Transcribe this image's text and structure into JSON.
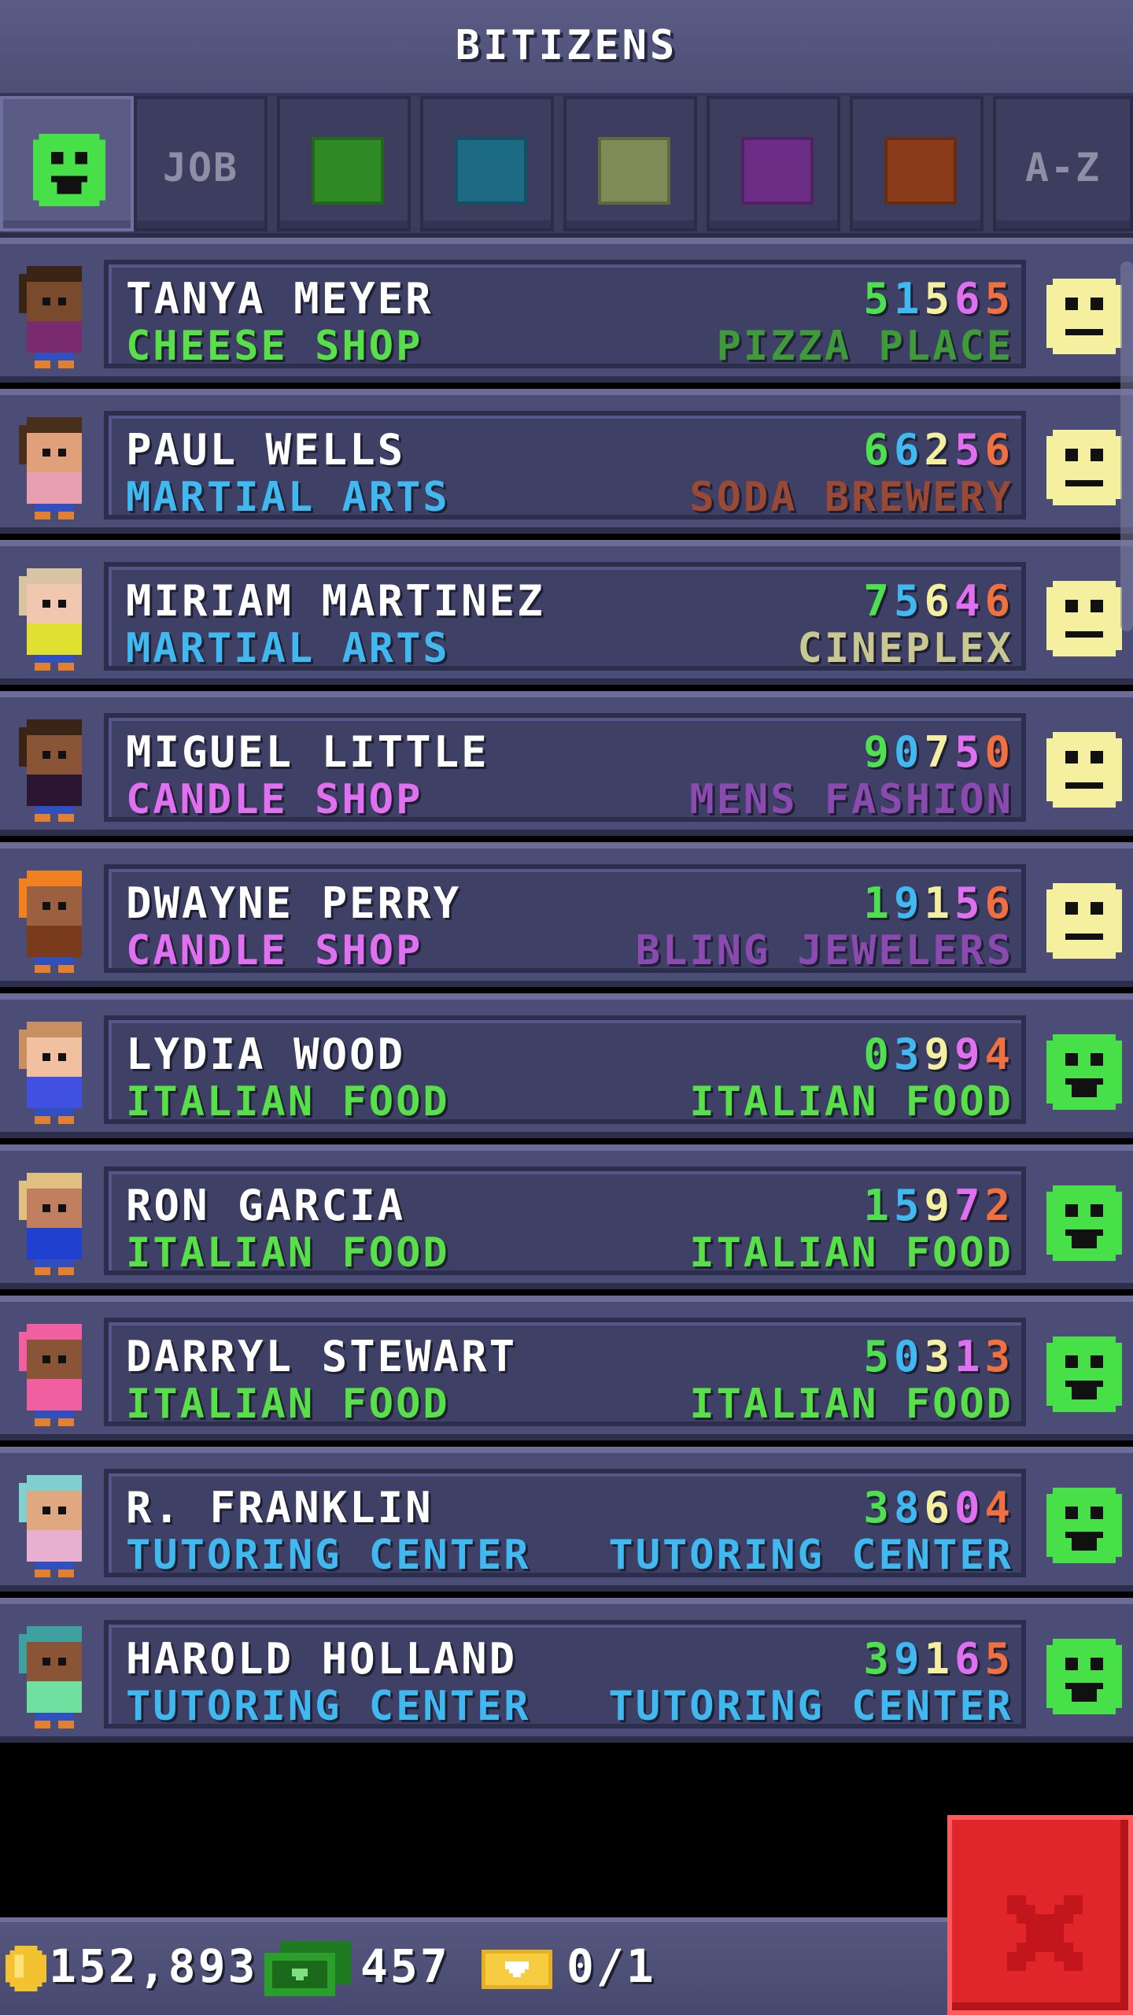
{
  "header": {
    "title": "BITIZENS"
  },
  "tabs": [
    {
      "kind": "icon",
      "icon": "happy-face-icon",
      "color": "#48e048",
      "label": ""
    },
    {
      "kind": "text",
      "label": "JOB"
    },
    {
      "kind": "color",
      "color": "#2f8a26",
      "label": ""
    },
    {
      "kind": "color",
      "color": "#1d6a85",
      "label": ""
    },
    {
      "kind": "color",
      "color": "#7f8a56",
      "label": ""
    },
    {
      "kind": "color",
      "color": "#6b2d86",
      "label": ""
    },
    {
      "kind": "color",
      "color": "#8a3c1a",
      "label": ""
    },
    {
      "kind": "text",
      "label": "A-Z"
    }
  ],
  "stat_colors": [
    "#4fe04f",
    "#40b8f0",
    "#f4f0a0",
    "#e070f0",
    "#f07040"
  ],
  "bitizens": [
    {
      "name": "TANYA MEYER",
      "stats": [
        "5",
        "1",
        "5",
        "6",
        "5"
      ],
      "job": "CHEESE SHOP",
      "job_color": "#58e048",
      "dream_job": "PIZZA PLACE",
      "dream_color": "#3f9a3a",
      "mood": "neutral",
      "skin": "#7a4a2c",
      "hair": "#3a2416",
      "shirt": "#7a2a6e"
    },
    {
      "name": "PAUL WELLS",
      "stats": [
        "6",
        "6",
        "2",
        "5",
        "6"
      ],
      "job": "MARTIAL ARTS",
      "job_color": "#40b8f0",
      "dream_job": "SODA BREWERY",
      "dream_color": "#9a4a34",
      "mood": "neutral",
      "skin": "#e0a07a",
      "hair": "#4a2e1c",
      "shirt": "#e8a0b0"
    },
    {
      "name": "MIRIAM MARTINEZ",
      "stats": [
        "7",
        "5",
        "6",
        "4",
        "6"
      ],
      "job": "MARTIAL ARTS",
      "job_color": "#40b8f0",
      "dream_job": "CINEPLEX",
      "dream_color": "#c8c890",
      "mood": "neutral",
      "skin": "#f0c8b0",
      "hair": "#d8c4a0",
      "shirt": "#e0e030"
    },
    {
      "name": "MIGUEL LITTLE",
      "stats": [
        "9",
        "0",
        "7",
        "5",
        "0"
      ],
      "job": "CANDLE SHOP",
      "job_color": "#e070f0",
      "dream_job": "MENS FASHION",
      "dream_color": "#8a4ab0",
      "mood": "neutral",
      "skin": "#8a5436",
      "hair": "#3a2416",
      "shirt": "#2a1630"
    },
    {
      "name": "DWAYNE PERRY",
      "stats": [
        "1",
        "9",
        "1",
        "5",
        "6"
      ],
      "job": "CANDLE SHOP",
      "job_color": "#e070f0",
      "dream_job": "BLING JEWELERS",
      "dream_color": "#8a4ab0",
      "mood": "neutral",
      "skin": "#9a6040",
      "hair": "#f08020",
      "shirt": "#7a3a1c"
    },
    {
      "name": "LYDIA WOOD",
      "stats": [
        "0",
        "3",
        "9",
        "9",
        "4"
      ],
      "job": "ITALIAN FOOD",
      "job_color": "#58e048",
      "dream_job": "ITALIAN FOOD",
      "dream_color": "#58e048",
      "mood": "happy",
      "skin": "#f0c0a0",
      "hair": "#c89060",
      "shirt": "#4050e0"
    },
    {
      "name": "RON GARCIA",
      "stats": [
        "1",
        "5",
        "9",
        "7",
        "2"
      ],
      "job": "ITALIAN FOOD",
      "job_color": "#58e048",
      "dream_job": "ITALIAN FOOD",
      "dream_color": "#58e048",
      "mood": "happy",
      "skin": "#c08060",
      "hair": "#e0c080",
      "shirt": "#2040d0"
    },
    {
      "name": "DARRYL STEWART",
      "stats": [
        "5",
        "0",
        "3",
        "1",
        "3"
      ],
      "job": "ITALIAN FOOD",
      "job_color": "#58e048",
      "dream_job": "ITALIAN FOOD",
      "dream_color": "#58e048",
      "mood": "happy",
      "skin": "#8a5436",
      "hair": "#f060a0",
      "shirt": "#f060a0"
    },
    {
      "name": "R. FRANKLIN",
      "stats": [
        "3",
        "8",
        "6",
        "0",
        "4"
      ],
      "job": "TUTORING CENTER",
      "job_color": "#40b8f0",
      "dream_job": "TUTORING CENTER",
      "dream_color": "#40b8f0",
      "mood": "happy",
      "skin": "#e0a880",
      "hair": "#80d0d0",
      "shirt": "#e8b0d0"
    },
    {
      "name": "HAROLD HOLLAND",
      "stats": [
        "3",
        "9",
        "1",
        "6",
        "5"
      ],
      "job": "TUTORING CENTER",
      "job_color": "#40b8f0",
      "dream_job": "TUTORING CENTER",
      "dream_color": "#40b8f0",
      "mood": "happy",
      "skin": "#8a5436",
      "hair": "#40a0a0",
      "shirt": "#70e0a0"
    }
  ],
  "currency": {
    "coins": "152,893",
    "bux": "457",
    "tickets": "0/1"
  },
  "close_button": {
    "icon": "close-icon"
  }
}
